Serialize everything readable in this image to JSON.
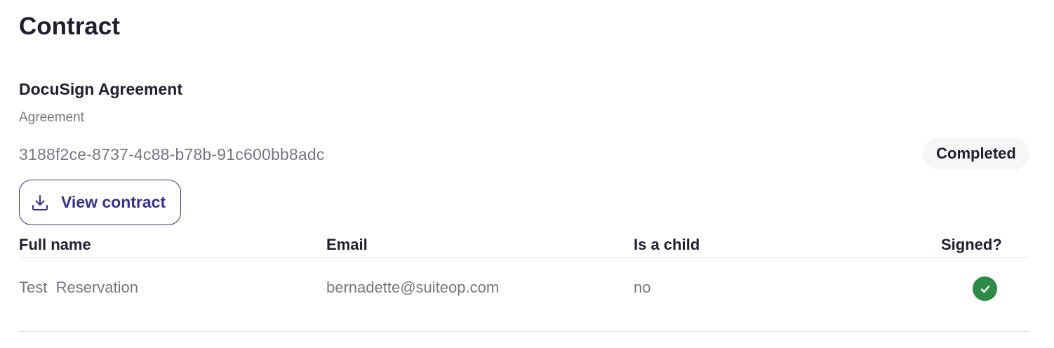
{
  "page": {
    "title": "Contract"
  },
  "agreement": {
    "title": "DocuSign Agreement",
    "subtitle": "Agreement",
    "id": "3188f2ce-8737-4c88-b78b-91c600bb8adc",
    "status": "Completed",
    "view_button_label": "View contract",
    "view_button_icon": "download-icon"
  },
  "signers_table": {
    "columns": [
      "Full name",
      "Email",
      "Is a child",
      "Signed?"
    ],
    "rows": [
      {
        "full_name": "Test  Reservation",
        "email": "bernadette@suiteop.com",
        "is_child": "no",
        "signed_icon": "check-circle-icon"
      }
    ]
  },
  "colors": {
    "accent": "#35318a",
    "signed": "#2e8b47",
    "muted_text": "#767680",
    "badge_bg": "#f6f6f7"
  }
}
